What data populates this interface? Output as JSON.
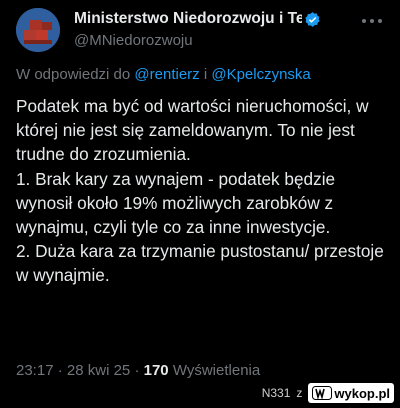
{
  "account": {
    "display_name": "Ministerstwo Niedorozwoju i Te",
    "handle": "@MNiedorozwoju"
  },
  "reply": {
    "prefix": "W odpowiedzi do",
    "user1": "@rentierz",
    "joiner": "i",
    "user2": "@Kpelczynska"
  },
  "tweet": {
    "lines": [
      "Podatek ma być od wartości nieruchomości, w której nie jest się zameldowanym. To nie jest trudne do zrozumienia.",
      "1. Brak kary za wynajem - podatek będzie wynosił około 19% możliwych zarobków z wynajmu, czyli tyle co za inne inwestycje.",
      "2. Duża kara za trzymanie pustostanu/ przestoje w wynajmie."
    ]
  },
  "meta": {
    "time": "23:17",
    "date": "28 kwi 25",
    "views_count": "170",
    "views_label": "Wyświetlenia"
  },
  "watermark": {
    "user": "N331",
    "z": "z",
    "site": "wykop.pl"
  },
  "colors": {
    "background": "#000000",
    "text": "#e7e9ea",
    "secondary": "#71767b",
    "link": "#1d9bf0"
  },
  "icons": [
    "verified-badge-icon",
    "more-options-icon",
    "wykop-logo-icon"
  ]
}
